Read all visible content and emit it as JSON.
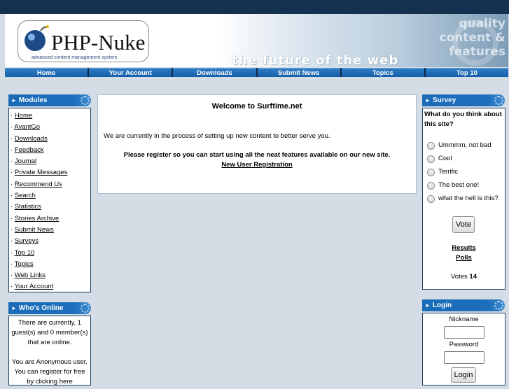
{
  "header": {
    "logo_text": "PHP-Nuke",
    "logo_subtitle": "advanced content management system",
    "tagline": "the future of the web",
    "quality_lines": [
      "quality",
      "content &",
      "features"
    ]
  },
  "nav": [
    "Home",
    "Your Account",
    "Downloads",
    "Submit News",
    "Topics",
    "Top 10"
  ],
  "modules": {
    "title": "Modules",
    "items": [
      "Home",
      "AvantGo",
      "Downloads",
      "Feedback",
      "Journal",
      "Private Messages",
      "Recommend Us",
      "Search",
      "Statistics",
      "Stories Archive",
      "Submit News",
      "Surveys",
      "Top 10",
      "Topics",
      "Web Links",
      "Your Account"
    ]
  },
  "whos_online": {
    "title": "Who's Online",
    "line1": "There are currently, 1 guest(s) and 0 member(s) that are online.",
    "line2": "You are Anonymous user. You can register for free by clicking here"
  },
  "center": {
    "title": "Welcome to Surftime.net",
    "intro": "We are currently in the process of setting up new content to better serve you.",
    "register_text": "Please register so you can start using all the neat features available on our new site.",
    "register_link": "New User Registration"
  },
  "survey": {
    "title": "Survey",
    "question": "What do you think about this site?",
    "options": [
      "Ummmm, not bad",
      "Cool",
      "Terrific",
      "The best one!",
      "what the hell is this?"
    ],
    "vote_button": "Vote",
    "results_link": "Results",
    "polls_link": "Polls",
    "votes_label": "Votes",
    "votes_count": "14"
  },
  "login": {
    "title": "Login",
    "nickname_label": "Nickname",
    "password_label": "Password",
    "login_button": "Login"
  },
  "colors": {
    "top_band": "#14314f",
    "nav_blue": "#1d6fbc",
    "page_bg": "#d4dde6"
  }
}
